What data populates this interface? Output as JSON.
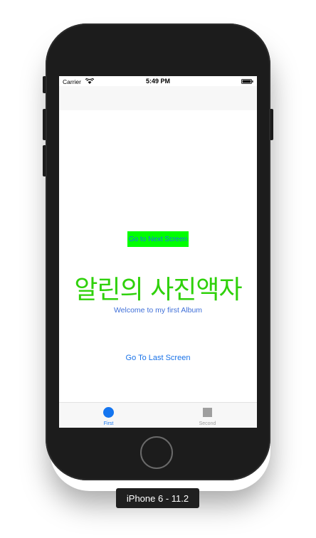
{
  "status_bar": {
    "carrier": "Carrier",
    "time": "5:49 PM",
    "wifi_icon": "wifi-icon",
    "battery_icon": "battery-icon"
  },
  "main": {
    "next_button_label": "Go to Next Screen",
    "title": "알린의 사진액자",
    "subtitle": "Welcome to my first Album",
    "last_button_label": "Go To Last Screen"
  },
  "tab_bar": {
    "tabs": [
      {
        "label": "First",
        "icon": "circle-icon",
        "selected": true
      },
      {
        "label": "Second",
        "icon": "square-icon",
        "selected": false
      }
    ]
  },
  "simulator": {
    "device_label": "iPhone 6 - 11.2"
  },
  "colors": {
    "title_green": "#2fd10a",
    "next_button_bg": "#00ff00",
    "link_blue": "#1a73e8",
    "tab_selected": "#1475f0",
    "tab_unselected": "#9e9e9e"
  }
}
